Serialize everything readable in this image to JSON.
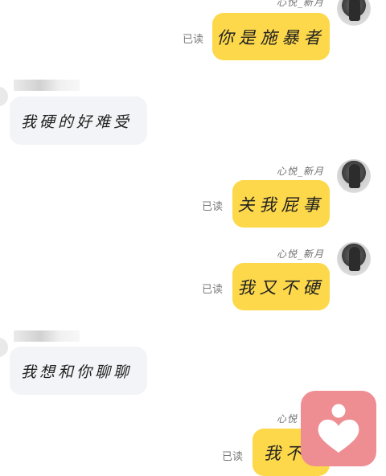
{
  "messages": [
    {
      "side": "right",
      "sender": "心悦_新月",
      "read": "已读",
      "text": "你是施暴者"
    },
    {
      "side": "left",
      "text": "我硬的好难受"
    },
    {
      "side": "right",
      "sender": "心悦_新月",
      "read": "已读",
      "text": "关我屁事"
    },
    {
      "side": "right",
      "sender": "心悦_新月",
      "read": "已读",
      "text": "我又不硬"
    },
    {
      "side": "left",
      "text": "我想和你聊聊"
    },
    {
      "side": "right",
      "sender": "心悦",
      "read": "已读",
      "text": "我不"
    }
  ],
  "colors": {
    "outgoing": "#fdd84a",
    "incoming": "#f3f4f7",
    "heart_button": "#ee8e93"
  },
  "icons": {
    "heart_app": "heart-icon"
  }
}
